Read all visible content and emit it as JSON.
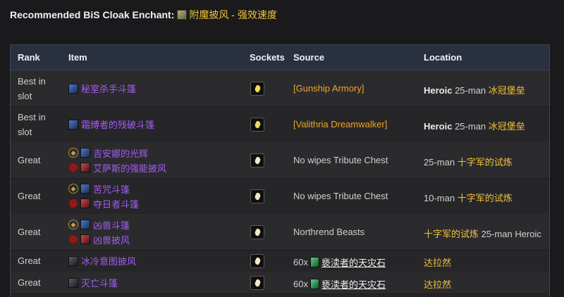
{
  "header": {
    "label": "Recommended BiS Cloak Enchant:",
    "enchant_icon": "cloak-enchant-icon",
    "enchant_name": "附魔披风 - 强效速度"
  },
  "table": {
    "columns": [
      "Rank",
      "Item",
      "Sockets",
      "Source",
      "Location"
    ],
    "rows": [
      {
        "rank": "Best in slot",
        "items": [
          {
            "faction": "",
            "name": "秘室杀手斗篷",
            "icon": "blue-cloak-icon"
          }
        ],
        "source": "[Gunship Armory]",
        "source_kind": "boss",
        "location": {
          "difficulty": "Heroic",
          "size": "25-man",
          "zone": "冰冠堡垒"
        }
      },
      {
        "rank": "Best in slot",
        "items": [
          {
            "faction": "",
            "name": "霜缚者的残破斗篷",
            "icon": "blue-cloak-icon"
          }
        ],
        "source": "[Valithria Dreamwalker]",
        "source_kind": "boss",
        "location": {
          "difficulty": "Heroic",
          "size": "25-man",
          "zone": "冰冠堡垒"
        }
      },
      {
        "rank": "Great",
        "items": [
          {
            "faction": "alliance",
            "name": "吉安娜的光辉",
            "icon": "blue-cloak-icon"
          },
          {
            "faction": "horde",
            "name": "艾萨斯的强能披风",
            "icon": "red-cloak-icon"
          }
        ],
        "source": "No wipes Tribute Chest",
        "source_kind": "text",
        "location": {
          "difficulty": "",
          "size": "25-man",
          "zone": "十字军的试炼"
        }
      },
      {
        "rank": "Great",
        "items": [
          {
            "faction": "alliance",
            "name": "苦咒斗篷",
            "icon": "blue-cloak-icon"
          },
          {
            "faction": "horde",
            "name": "夺日者斗篷",
            "icon": "red-cloak-icon"
          }
        ],
        "source": "No wipes Tribute Chest",
        "source_kind": "text",
        "location": {
          "difficulty": "",
          "size": "10-man",
          "zone": "十字军的试炼"
        }
      },
      {
        "rank": "Great",
        "items": [
          {
            "faction": "alliance",
            "name": "凶兽斗篷",
            "icon": "blue-cloak-icon"
          },
          {
            "faction": "horde",
            "name": "凶兽披风",
            "icon": "red-cloak-icon"
          }
        ],
        "source": "Northrend Beasts",
        "source_kind": "text",
        "location": {
          "difficulty": "",
          "size": "25-man Heroic",
          "zone": "十字军的试炼",
          "zone_first": true
        }
      },
      {
        "rank": "Great",
        "items": [
          {
            "faction": "",
            "name": "冰冷意图披风",
            "icon": "dark-cloak-icon"
          }
        ],
        "source": "60x",
        "source_currency": "亵渎者的天灾石",
        "source_kind": "currency",
        "location": {
          "difficulty": "",
          "size": "",
          "zone": "达拉然"
        }
      },
      {
        "rank": "Great",
        "items": [
          {
            "faction": "",
            "name": "灭亡斗篷",
            "icon": "dark-cloak-icon"
          }
        ],
        "source": "60x",
        "source_currency": "亵渎者的天灾石",
        "source_kind": "currency",
        "location": {
          "difficulty": "",
          "size": "",
          "zone": "达拉然"
        }
      }
    ]
  },
  "colors": {
    "epic_item": "#a35cf2",
    "zone_link": "#f0c23b",
    "boss_link": "#f0a422",
    "header_bg": "#293040",
    "body_bg": "#1a1a1d"
  }
}
